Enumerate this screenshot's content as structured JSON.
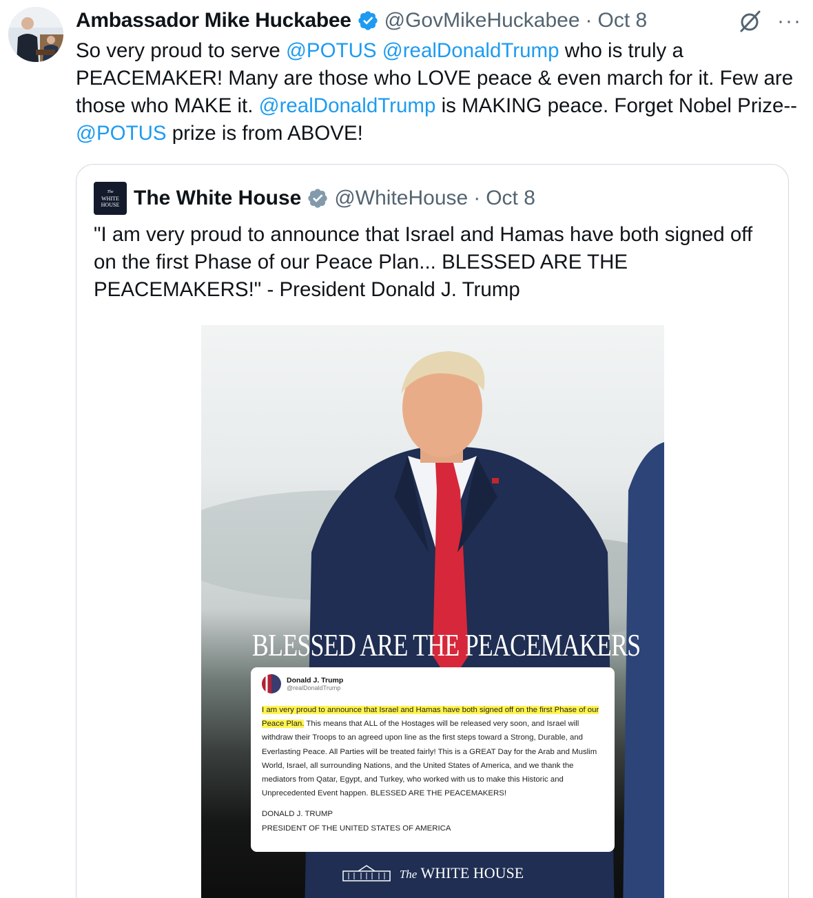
{
  "author": {
    "display_name": "Ambassador Mike Huckabee",
    "handle": "@GovMikeHuckabee",
    "separator": "·",
    "date": "Oct 8",
    "verified_color": "#1d9bf0"
  },
  "actions": {
    "grok_icon": "grok-icon",
    "more_label": "···"
  },
  "tweet": {
    "segments": [
      {
        "text": "So very proud to serve ",
        "mention": false
      },
      {
        "text": "@POTUS",
        "mention": true
      },
      {
        "text": " ",
        "mention": false
      },
      {
        "text": "@realDonaldTrump",
        "mention": true
      },
      {
        "text": " who is truly a PEACEMAKER! Many are those who LOVE peace & even march for it. Few are those who MAKE it. ",
        "mention": false
      },
      {
        "text": "@realDonaldTrump",
        "mention": true
      },
      {
        "text": " is MAKING peace.  Forget Nobel Prize--",
        "mention": false
      },
      {
        "text": "@POTUS",
        "mention": true
      },
      {
        "text": " prize is from ABOVE!",
        "mention": false
      }
    ],
    "mention_color": "#1d9bf0"
  },
  "quote": {
    "display_name": "The White House",
    "handle": "@WhiteHouse",
    "separator": "·",
    "date": "Oct 8",
    "verified_color": "#829aab",
    "logo_text": [
      "The",
      "WHITE",
      "HOUSE"
    ],
    "text": "\"I am very proud to announce that Israel and Hamas have both signed off on the first Phase of our Peace Plan... BLESSED ARE THE PEACEMAKERS!\" - President Donald J. Trump"
  },
  "media": {
    "headline": "BLESSED ARE THE PEACEMAKERS",
    "card": {
      "name": "Donald J. Trump",
      "handle": "@realDonaldTrump",
      "highlighted": "I am very proud to announce that Israel and Hamas have both signed off on the first Phase of our Peace Plan.",
      "body": " This means that ALL of the Hostages will be released very soon, and Israel will withdraw their Troops to an agreed upon line as the first steps toward a Strong, Durable, and Everlasting Peace. All Parties will be treated fairly! This is a GREAT Day for the Arab and Muslim World, Israel, all surrounding Nations, and the United States of America, and we thank the mediators from Qatar, Egypt, and Turkey, who worked with us to make this Historic and Unprecedented Event happen. BLESSED ARE THE PEACEMAKERS!",
      "sign_name": "DONALD J. TRUMP",
      "sign_title": "PRESIDENT OF THE UNITED STATES OF AMERICA",
      "highlight_color": "#fff44f"
    },
    "footer_prefix": "The",
    "footer_brand": "WHITE HOUSE"
  }
}
